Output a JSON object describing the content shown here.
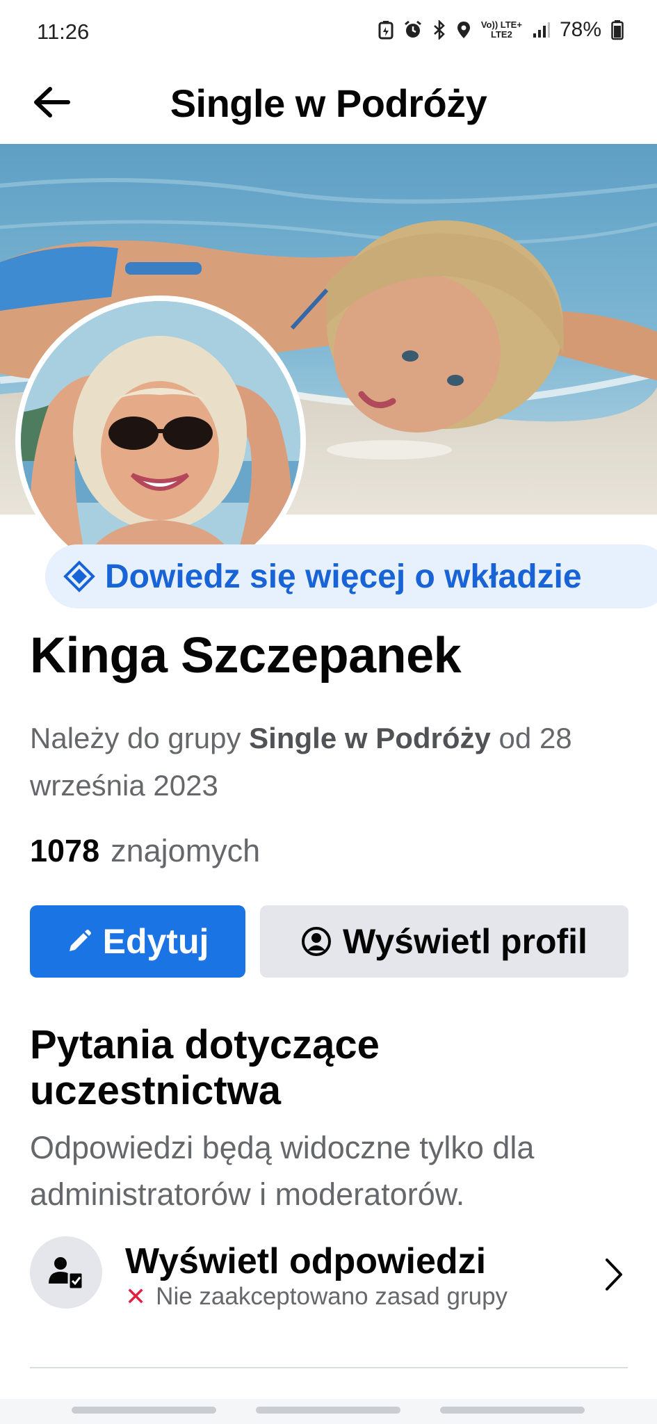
{
  "status_bar": {
    "time": "11:26",
    "network_top": "Vo)) LTE+",
    "network_bottom": "LTE2",
    "battery": "78%"
  },
  "header": {
    "title": "Single w Podróży",
    "back_icon": "arrow-left-icon"
  },
  "badge": {
    "icon": "diamond-badge-icon",
    "label": "Dowiedz się więcej o wkładzie"
  },
  "profile": {
    "name": "Kinga Szczepanek",
    "membership_prefix": "Należy do grupy ",
    "membership_group": "Single w Podróży",
    "membership_suffix": " od 28 września 2023",
    "friends_count": "1078",
    "friends_label": "znajomych"
  },
  "actions": {
    "edit_label": "Edytuj",
    "view_profile_label": "Wyświetl profil"
  },
  "questions": {
    "title": "Pytania dotyczące uczestnictwa",
    "subtitle": "Odpowiedzi będą widoczne tylko dla administratorów i moderatorów.",
    "answers_title": "Wyświetl odpowiedzi",
    "answers_status": "Nie zaakceptowano zasad grupy"
  },
  "colors": {
    "accent": "#1b74e4",
    "badge_bg": "#e7f0fd",
    "badge_text": "#1863d6",
    "secondary_button": "#e4e6eb",
    "error": "#e41e3f",
    "muted_text": "#65676b"
  }
}
